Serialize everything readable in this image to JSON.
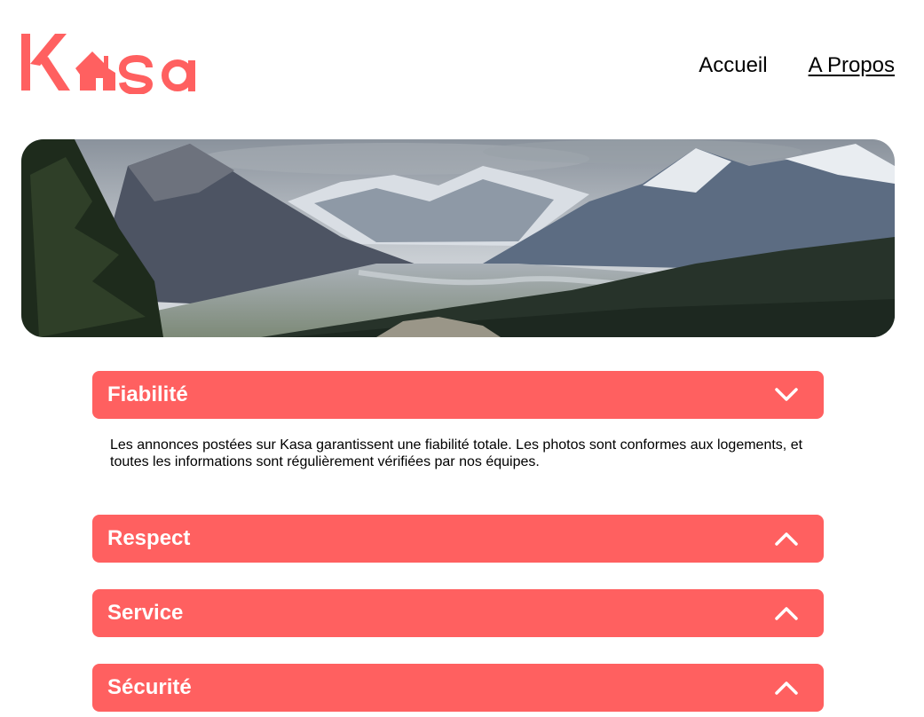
{
  "header": {
    "logo_alt": "Kasa",
    "nav": [
      {
        "label": "Accueil",
        "active": false
      },
      {
        "label": "A Propos",
        "active": true
      }
    ]
  },
  "banner": {
    "description": "Mountain valley landscape"
  },
  "sections": [
    {
      "title": "Fiabilité",
      "open": true,
      "chevron": "chevron-down-icon",
      "content": "Les annonces postées sur Kasa garantissent une fiabilité totale. Les photos sont conformes aux logements, et toutes les informations sont régulièrement vérifiées par nos équipes."
    },
    {
      "title": "Respect",
      "open": false,
      "chevron": "chevron-up-icon"
    },
    {
      "title": "Service",
      "open": false,
      "chevron": "chevron-up-icon"
    },
    {
      "title": "Sécurité",
      "open": false,
      "chevron": "chevron-up-icon"
    }
  ],
  "colors": {
    "brand": "#FF6060",
    "text": "#000000",
    "background": "#FFFFFF"
  }
}
